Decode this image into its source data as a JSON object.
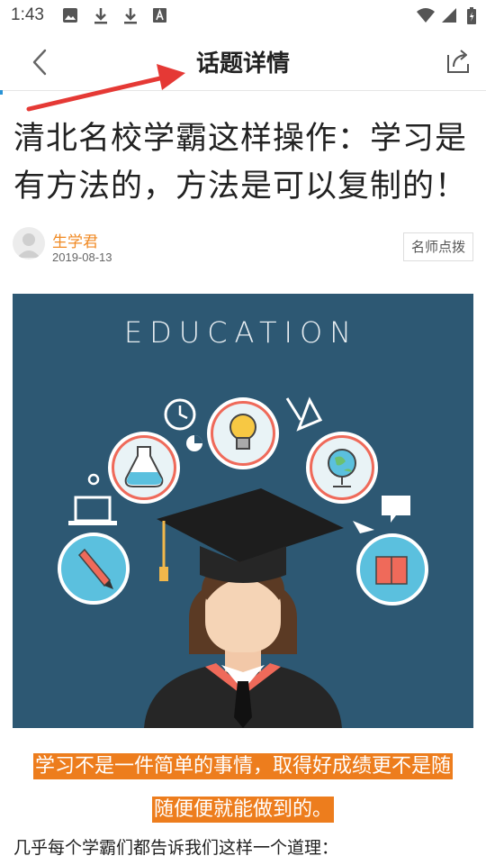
{
  "status_bar": {
    "time": "1:43"
  },
  "header": {
    "title": "话题详情"
  },
  "article": {
    "title_line1": "清北名校学霸这样操作：学习是",
    "title_line2": "有方法的，方法是可以复制的！",
    "author": {
      "name": "生学君",
      "date": "2019-08-13"
    },
    "tag": "名师点拨",
    "image": {
      "caption": "EDUCATION"
    },
    "highlight_line1": "学习不是一件简单的事情，取得好成绩更不是随",
    "highlight_line2": "随便便就能做到的。",
    "paragraph": "几乎每个学霸们都告诉我们这样一个道理："
  },
  "colors": {
    "accent": "#ed7d1d",
    "author": "#f08a24",
    "hero_bg": "#2d5873",
    "arrow": "#e53935"
  }
}
